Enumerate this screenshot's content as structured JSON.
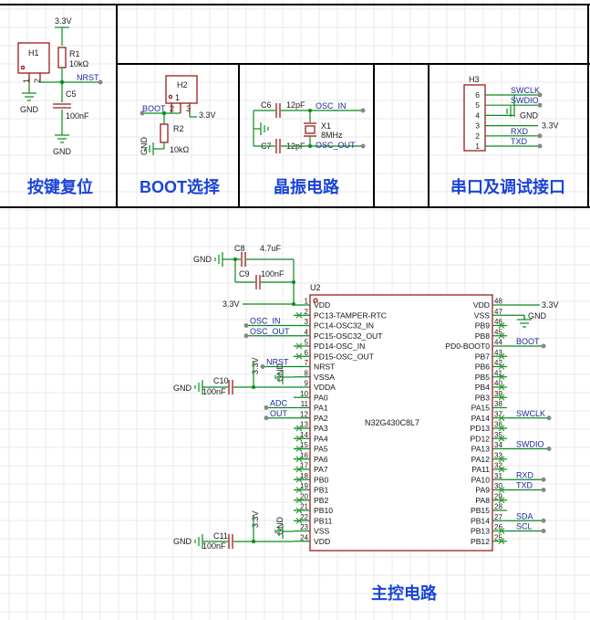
{
  "sections": {
    "reset": {
      "title": "按键复位"
    },
    "boot": {
      "title": "BOOT选择"
    },
    "crystal": {
      "title": "晶振电路"
    },
    "debug": {
      "title": "串口及调试接口"
    },
    "main": {
      "title": "主控电路"
    }
  },
  "reset": {
    "h1": "H1",
    "h1_pins": [
      "1",
      "2"
    ],
    "r1": "R1",
    "r1_val": "10kΩ",
    "c5": "C5",
    "c5_val": "100nF",
    "vcc": "3.3V",
    "gnd1": "GND",
    "gnd2": "GND",
    "net": "NRST"
  },
  "boot": {
    "h2": "H2",
    "h2_pins": [
      "1",
      "2",
      "3"
    ],
    "r2": "R2",
    "r2_val": "10kΩ",
    "vcc": "3.3V",
    "net": "BOOT",
    "gnd": "GND"
  },
  "crystal": {
    "c6": "C6",
    "c6_val": "12pF",
    "c7": "C7",
    "c7_val": "12pF",
    "x1": "X1",
    "x1_val": "8MHz",
    "net_in": "OSC_IN",
    "net_out": "OSC_OUT"
  },
  "debug": {
    "h3": "H3",
    "pins": [
      {
        "num": "6",
        "net": "SWCLK"
      },
      {
        "num": "5",
        "net": "SWDIO"
      },
      {
        "num": "4",
        "net": "GND"
      },
      {
        "num": "3",
        "net": "3.3V"
      },
      {
        "num": "2",
        "net": "RXD"
      },
      {
        "num": "1",
        "net": "TXD"
      }
    ]
  },
  "mcu": {
    "ref": "U2",
    "part": "N32G430C8L7",
    "left_pins": [
      {
        "num": "1",
        "name": "VDD"
      },
      {
        "num": "2",
        "name": "PC13-TAMPER-RTC"
      },
      {
        "num": "3",
        "name": "PC14-OSC32_IN"
      },
      {
        "num": "4",
        "name": "PC15-OSC32_OUT"
      },
      {
        "num": "5",
        "name": "PD14-OSC_IN"
      },
      {
        "num": "6",
        "name": "PD15-OSC_OUT"
      },
      {
        "num": "7",
        "name": "NRST"
      },
      {
        "num": "8",
        "name": "VSSA"
      },
      {
        "num": "9",
        "name": "VDDA"
      },
      {
        "num": "10",
        "name": "PA0"
      },
      {
        "num": "11",
        "name": "PA1"
      },
      {
        "num": "12",
        "name": "PA2"
      },
      {
        "num": "13",
        "name": "PA3"
      },
      {
        "num": "14",
        "name": "PA4"
      },
      {
        "num": "15",
        "name": "PA5"
      },
      {
        "num": "16",
        "name": "PA6"
      },
      {
        "num": "17",
        "name": "PA7"
      },
      {
        "num": "18",
        "name": "PB0"
      },
      {
        "num": "19",
        "name": "PB1"
      },
      {
        "num": "20",
        "name": "PB2"
      },
      {
        "num": "21",
        "name": "PB10"
      },
      {
        "num": "22",
        "name": "PB11"
      },
      {
        "num": "23",
        "name": "VSS"
      },
      {
        "num": "24",
        "name": "VDD"
      }
    ],
    "right_pins": [
      {
        "num": "48",
        "name": "VDD"
      },
      {
        "num": "47",
        "name": "VSS"
      },
      {
        "num": "46",
        "name": "PB9"
      },
      {
        "num": "45",
        "name": "PB8"
      },
      {
        "num": "44",
        "name": "PD0-BOOT0"
      },
      {
        "num": "43",
        "name": "PB7"
      },
      {
        "num": "42",
        "name": "PB6"
      },
      {
        "num": "41",
        "name": "PB5"
      },
      {
        "num": "40",
        "name": "PB4"
      },
      {
        "num": "39",
        "name": "PB3"
      },
      {
        "num": "38",
        "name": "PA15"
      },
      {
        "num": "37",
        "name": "PA14"
      },
      {
        "num": "36",
        "name": "PD13"
      },
      {
        "num": "35",
        "name": "PD12"
      },
      {
        "num": "34",
        "name": "PA13"
      },
      {
        "num": "33",
        "name": "PA12"
      },
      {
        "num": "32",
        "name": "PA11"
      },
      {
        "num": "31",
        "name": "PA10"
      },
      {
        "num": "30",
        "name": "PA9"
      },
      {
        "num": "29",
        "name": "PA8"
      },
      {
        "num": "28",
        "name": "PB15"
      },
      {
        "num": "27",
        "name": "PB14"
      },
      {
        "num": "26",
        "name": "PB13"
      },
      {
        "num": "25",
        "name": "PB12"
      }
    ]
  },
  "main": {
    "c8": "C8",
    "c8_val": "4.7uF",
    "c9": "C9",
    "c9_val": "100nF",
    "c10": "C10",
    "c10_val": "100nF",
    "c11": "C11",
    "c11_val": "100nF",
    "gnd": "GND",
    "vcc": "3.3V",
    "nets": {
      "osc_in": "OSC_IN",
      "osc_out": "OSC_OUT",
      "nrst": "NRST",
      "adc": "ADC",
      "out": "OUT",
      "boot": "BOOT",
      "swclk": "SWCLK",
      "swdio": "SWDIO",
      "rxd": "RXD",
      "txd": "TXD",
      "sda": "SDA",
      "scl": "SCL"
    }
  }
}
